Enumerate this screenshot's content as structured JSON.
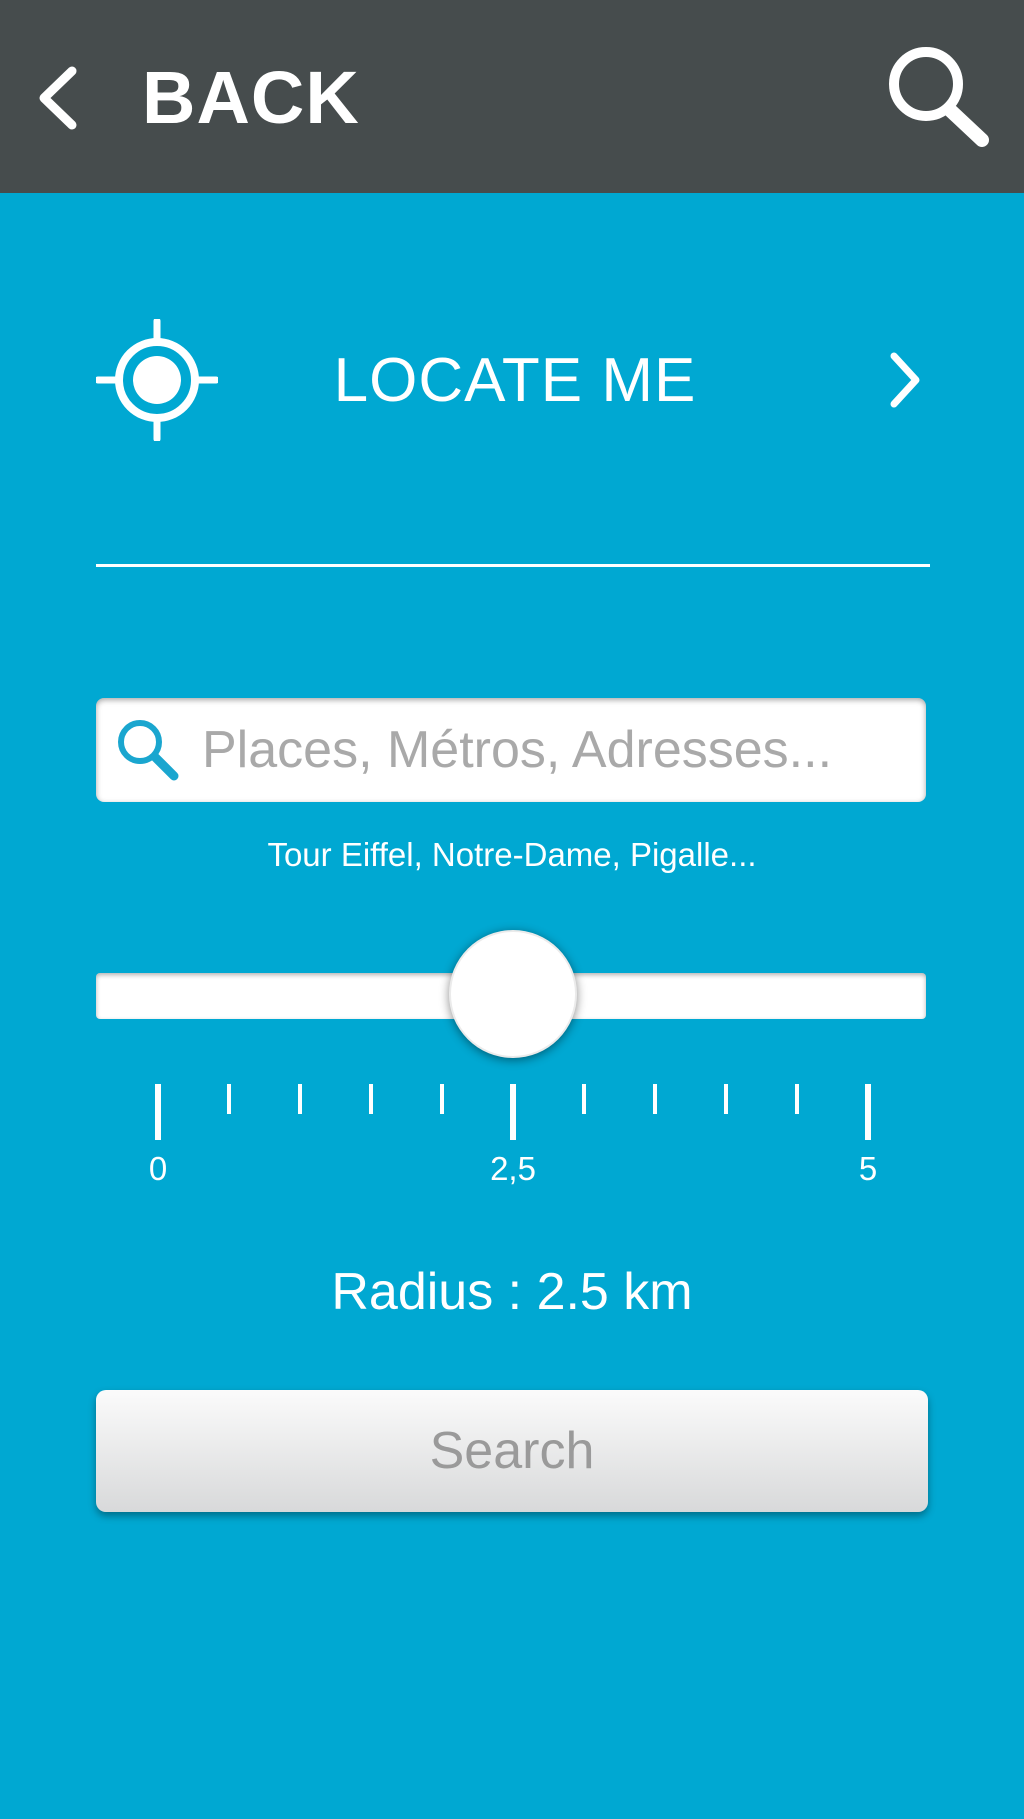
{
  "header": {
    "back_label": "BACK",
    "back_icon": "chevron-left-icon",
    "search_icon": "search-icon"
  },
  "locate": {
    "label": "LOCATE ME",
    "icon": "crosshair-icon",
    "chevron_icon": "chevron-right-icon"
  },
  "search": {
    "placeholder": "Places, Métros, Adresses...",
    "value": "",
    "icon": "search-icon",
    "hint": "Tour Eiffel, Notre-Dame, Pigalle..."
  },
  "slider": {
    "min": 0,
    "max": 5,
    "value": 2.5,
    "labels": {
      "min": "0",
      "mid": "2,5",
      "max": "5"
    }
  },
  "radius_text": "Radius : 2.5 km",
  "search_button_label": "Search",
  "colors": {
    "header_bg": "#464c4d",
    "page_bg": "#00a8d2",
    "accent_icon": "#1aa6cf",
    "button_text": "#9a9a9a"
  }
}
